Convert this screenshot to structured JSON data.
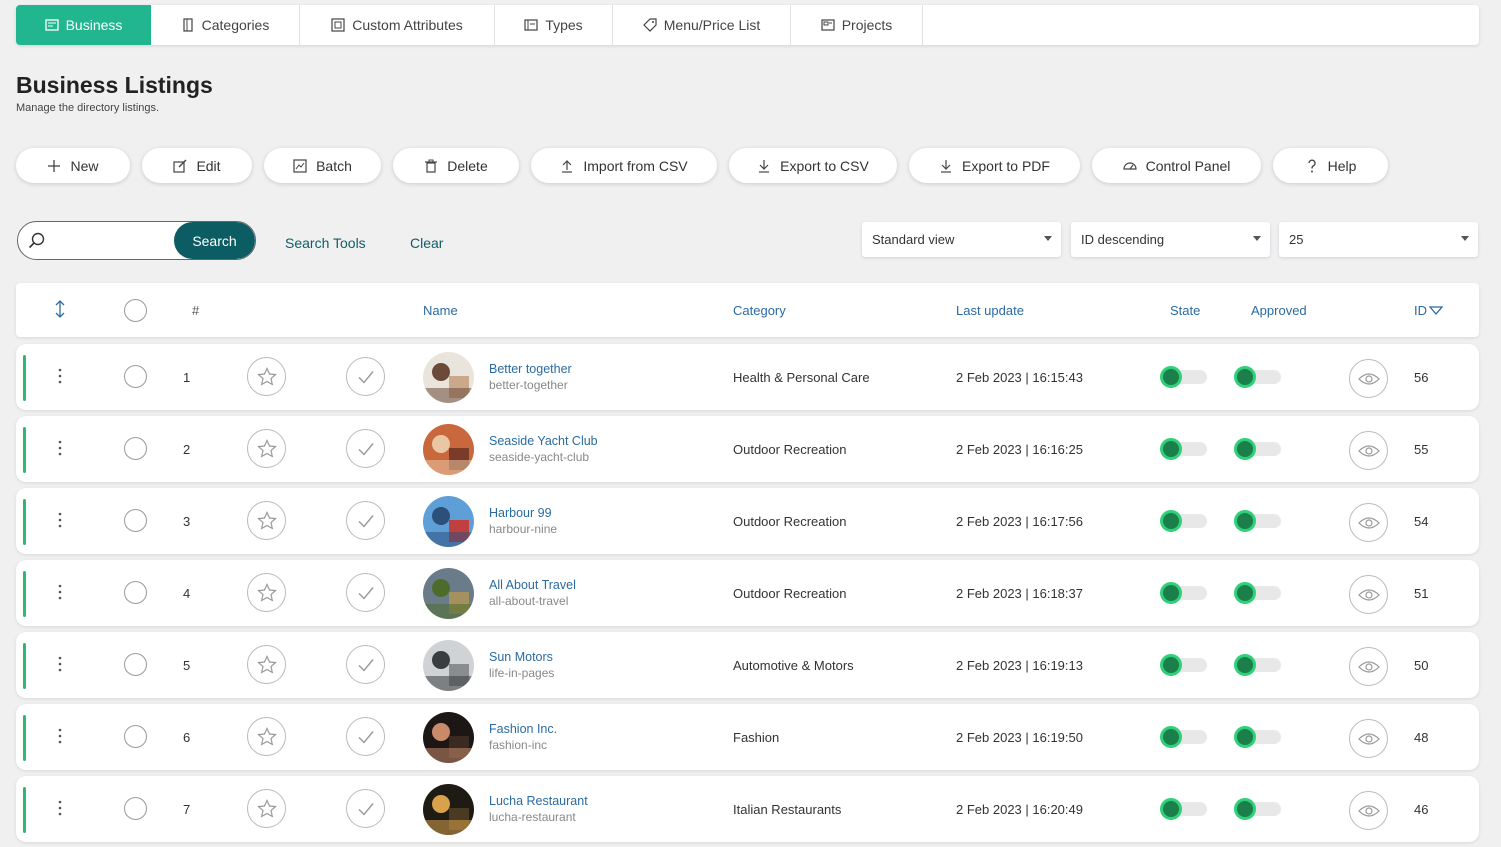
{
  "tabs": [
    {
      "label": "Business",
      "icon": "business-icon",
      "active": true
    },
    {
      "label": "Categories",
      "icon": "categories-icon"
    },
    {
      "label": "Custom Attributes",
      "icon": "attributes-icon"
    },
    {
      "label": "Types",
      "icon": "types-icon"
    },
    {
      "label": "Menu/Price List",
      "icon": "tag-icon"
    },
    {
      "label": "Projects",
      "icon": "projects-icon"
    }
  ],
  "page": {
    "title": "Business Listings",
    "subtitle": "Manage the directory listings."
  },
  "toolbar": [
    {
      "label": "New",
      "icon": "plus-icon"
    },
    {
      "label": "Edit",
      "icon": "edit-icon"
    },
    {
      "label": "Batch",
      "icon": "batch-icon"
    },
    {
      "label": "Delete",
      "icon": "trash-icon"
    },
    {
      "label": "Import from CSV",
      "icon": "upload-icon"
    },
    {
      "label": "Export to CSV",
      "icon": "download-icon"
    },
    {
      "label": "Export to PDF",
      "icon": "download-icon"
    },
    {
      "label": "Control Panel",
      "icon": "dashboard-icon"
    },
    {
      "label": "Help",
      "icon": "question-icon"
    }
  ],
  "search": {
    "value": "",
    "placeholder": "",
    "button": "Search",
    "tools": "Search Tools",
    "clear": "Clear"
  },
  "filters": {
    "view": "Standard view",
    "ordering": "ID descending",
    "limit": "25"
  },
  "columns": {
    "num": "#",
    "name": "Name",
    "category": "Category",
    "last_update": "Last update",
    "state": "State",
    "approved": "Approved",
    "id": "ID"
  },
  "rows": [
    {
      "num": "1",
      "name": "Better together",
      "alias": "better-together",
      "category": "Health & Personal Care",
      "updated": "2 Feb 2023 | 16:15:43",
      "id": "56",
      "state": true,
      "approved": true,
      "avatar_colors": [
        "#e9e4dc",
        "#6b4a3a",
        "#c9a98a"
      ]
    },
    {
      "num": "2",
      "name": "Seaside Yacht Club",
      "alias": "seaside-yacht-club",
      "category": "Outdoor Recreation",
      "updated": "2 Feb 2023 | 16:16:25",
      "id": "55",
      "state": true,
      "approved": true,
      "avatar_colors": [
        "#c9683d",
        "#e9c6a4",
        "#7a3b28"
      ]
    },
    {
      "num": "3",
      "name": "Harbour 99",
      "alias": "harbour-nine",
      "category": "Outdoor Recreation",
      "updated": "2 Feb 2023 | 16:17:56",
      "id": "54",
      "state": true,
      "approved": true,
      "avatar_colors": [
        "#5f9fd8",
        "#2d4f7c",
        "#c04040"
      ]
    },
    {
      "num": "4",
      "name": "All About Travel",
      "alias": "all-about-travel",
      "category": "Outdoor Recreation",
      "updated": "2 Feb 2023 | 16:18:37",
      "id": "51",
      "state": true,
      "approved": true,
      "avatar_colors": [
        "#6a7c8a",
        "#4f6b2c",
        "#a59060"
      ]
    },
    {
      "num": "5",
      "name": "Sun Motors",
      "alias": "life-in-pages",
      "category": "Automotive & Motors",
      "updated": "2 Feb 2023 | 16:19:13",
      "id": "50",
      "state": true,
      "approved": true,
      "avatar_colors": [
        "#cfd3d6",
        "#3b3d40",
        "#8a8d90"
      ]
    },
    {
      "num": "6",
      "name": "Fashion Inc.",
      "alias": "fashion-inc",
      "category": "Fashion",
      "updated": "2 Feb 2023 | 16:19:50",
      "id": "48",
      "state": true,
      "approved": true,
      "avatar_colors": [
        "#1c1614",
        "#c98a6a",
        "#3a2a22"
      ]
    },
    {
      "num": "7",
      "name": "Lucha Restaurant",
      "alias": "lucha-restaurant",
      "category": "Italian Restaurants",
      "updated": "2 Feb 2023 | 16:20:49",
      "id": "46",
      "state": true,
      "approved": true,
      "avatar_colors": [
        "#1e1a14",
        "#d8a24a",
        "#4a3a22"
      ]
    }
  ],
  "colors": {
    "accent": "#21b590",
    "search_button": "#0b5d63",
    "link": "#2a6ba3",
    "toggle_on": "#2fd078",
    "row_bar": "#2eb872"
  }
}
